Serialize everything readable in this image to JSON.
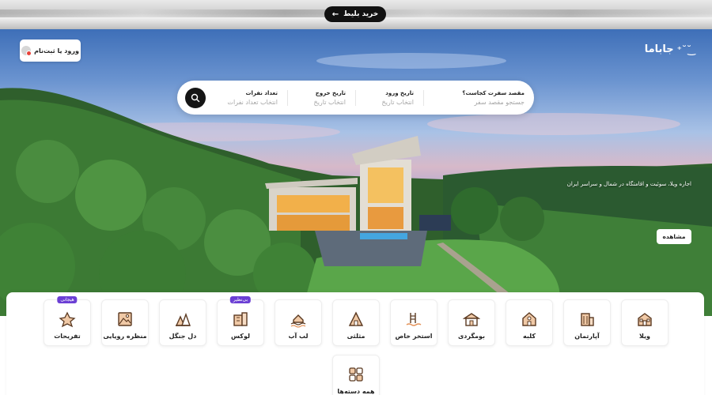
{
  "top_banner": {
    "buy_ticket_label": "خرید بلیط"
  },
  "header": {
    "logo_text": "جاباما",
    "login_label": "ورود یا ثبت‌نام"
  },
  "search": {
    "destination": {
      "label": "مقصد سفرت کجاست؟",
      "placeholder": "جستجو مقصد سفر"
    },
    "check_in": {
      "label": "تاریخ ورود",
      "placeholder": "انتخاب تاریخ"
    },
    "check_out": {
      "label": "تاریخ خروج",
      "placeholder": "انتخاب تاریخ"
    },
    "guests": {
      "label": "تعداد نفرات",
      "placeholder": "انتخاب تعداد نفرات"
    }
  },
  "hero": {
    "tagline": "اجاره ویلا، سوئیت و اقامتگاه در شمال و سراسر ایران",
    "view_label": "مشاهده"
  },
  "categories": [
    {
      "label": "ویلا",
      "icon": "villa-icon"
    },
    {
      "label": "آپارتمان",
      "icon": "apartment-icon"
    },
    {
      "label": "کلبه",
      "icon": "cabin-icon"
    },
    {
      "label": "بومگردی",
      "icon": "ecolodge-icon"
    },
    {
      "label": "استخر خاص",
      "icon": "pool-icon"
    },
    {
      "label": "مثلثی",
      "icon": "a-frame-icon"
    },
    {
      "label": "لب آب",
      "icon": "waterfront-icon"
    },
    {
      "label": "لوکس",
      "icon": "luxury-icon",
      "badge": "بی‌نظیر"
    },
    {
      "label": "دل جنگل",
      "icon": "forest-icon"
    },
    {
      "label": "منظره رویایی",
      "icon": "view-icon"
    },
    {
      "label": "تفریحات",
      "icon": "activities-icon",
      "badge": "هیجانی"
    },
    {
      "label": "همه دسته‌ها",
      "icon": "all-categories-icon"
    }
  ]
}
